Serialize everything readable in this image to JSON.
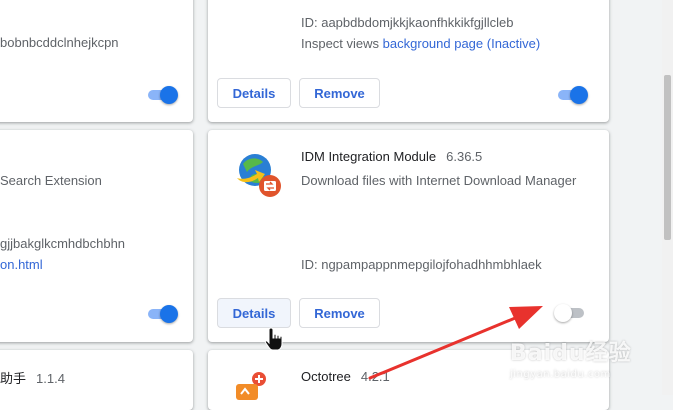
{
  "cards": {
    "top_left": {
      "id_fragment": "bobnbcddclnhejkcpn"
    },
    "top_right": {
      "id_label": "ID: aapbdbdomjkkjkaonfhkkikfgjllcleb",
      "inspect_prefix": "Inspect views",
      "inspect_link": "background page (Inactive)",
      "details_label": "Details",
      "remove_label": "Remove"
    },
    "mid_left": {
      "description_fragment": "Search Extension",
      "id_fragment": "gjjbakglkcmhdbchbhn",
      "link_fragment": "on.html"
    },
    "idm": {
      "name": "IDM Integration Module",
      "version": "6.36.5",
      "description": "Download files with Internet Download Manager",
      "id_label": "ID: ngpampappnmepgilojfohadhhmbhlaek",
      "details_label": "Details",
      "remove_label": "Remove"
    },
    "bottom_left": {
      "name_fragment": "助手",
      "version": "1.1.4"
    },
    "octotree": {
      "name": "Octotree",
      "version": "4.2.1"
    }
  },
  "toggles": {
    "top_left_enabled": true,
    "top_right_enabled": true,
    "mid_left_enabled": true,
    "idm_enabled": false
  },
  "icons": {
    "idm": "idm-globe-arrow-icon",
    "octotree": "octotree-icon",
    "cursor": "hand-pointer-icon"
  },
  "colors": {
    "accent": "#1a73e8",
    "link": "#3367d6",
    "annotation_arrow": "#e8322d"
  },
  "watermark": {
    "text": "Baidu经验",
    "sub": "jingyan.baidu.com"
  }
}
